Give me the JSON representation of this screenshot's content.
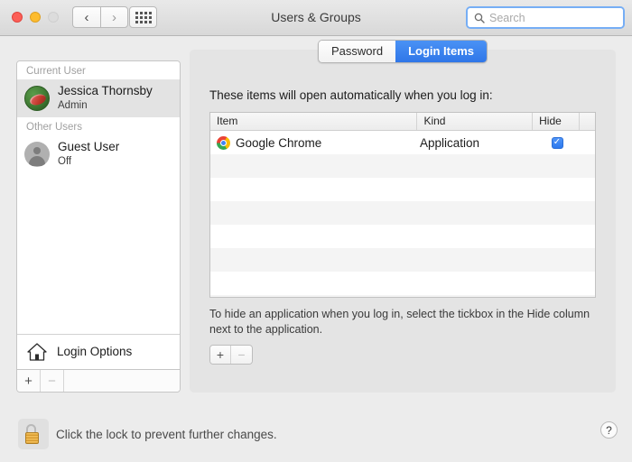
{
  "window": {
    "title": "Users & Groups",
    "controls": {
      "close": "close",
      "minimize": "minimize",
      "zoom": "zoom"
    },
    "nav": {
      "back": "‹",
      "forward": "›"
    },
    "grid_button": "show-all-preferences"
  },
  "search": {
    "placeholder": "Search",
    "value": ""
  },
  "sidebar": {
    "groups": [
      {
        "header": "Current User",
        "users": [
          {
            "name": "Jessica Thornsby",
            "role": "Admin",
            "avatar": "photo-avatar",
            "selected": true
          }
        ]
      },
      {
        "header": "Other Users",
        "users": [
          {
            "name": "Guest User",
            "role": "Off",
            "avatar": "person-avatar",
            "selected": false
          }
        ]
      }
    ],
    "login_options": {
      "label": "Login Options",
      "icon": "house-icon"
    },
    "footer": {
      "add": "+",
      "remove": "−"
    }
  },
  "content": {
    "tabs": [
      {
        "label": "Password",
        "active": false
      },
      {
        "label": "Login Items",
        "active": true
      }
    ],
    "intro": "These items will open automatically when you log in:",
    "table": {
      "columns": [
        "Item",
        "Kind",
        "Hide"
      ],
      "rows": [
        {
          "item": "Google Chrome",
          "icon": "chrome-icon",
          "kind": "Application",
          "hide": true
        }
      ],
      "empty_rows": 7
    },
    "hint": "To hide an application when you log in, select the tickbox in the Hide column next to the application.",
    "buttons": {
      "add": "+",
      "remove": "−"
    }
  },
  "footer": {
    "lock_text": "Click the lock to prevent further changes.",
    "lock_state": "unlocked",
    "help": "?"
  },
  "colors": {
    "accent": "#2f76e8",
    "window_bg": "#ececec",
    "panel_bg": "#e4e4e4",
    "checkbox": "#3d82f0"
  }
}
